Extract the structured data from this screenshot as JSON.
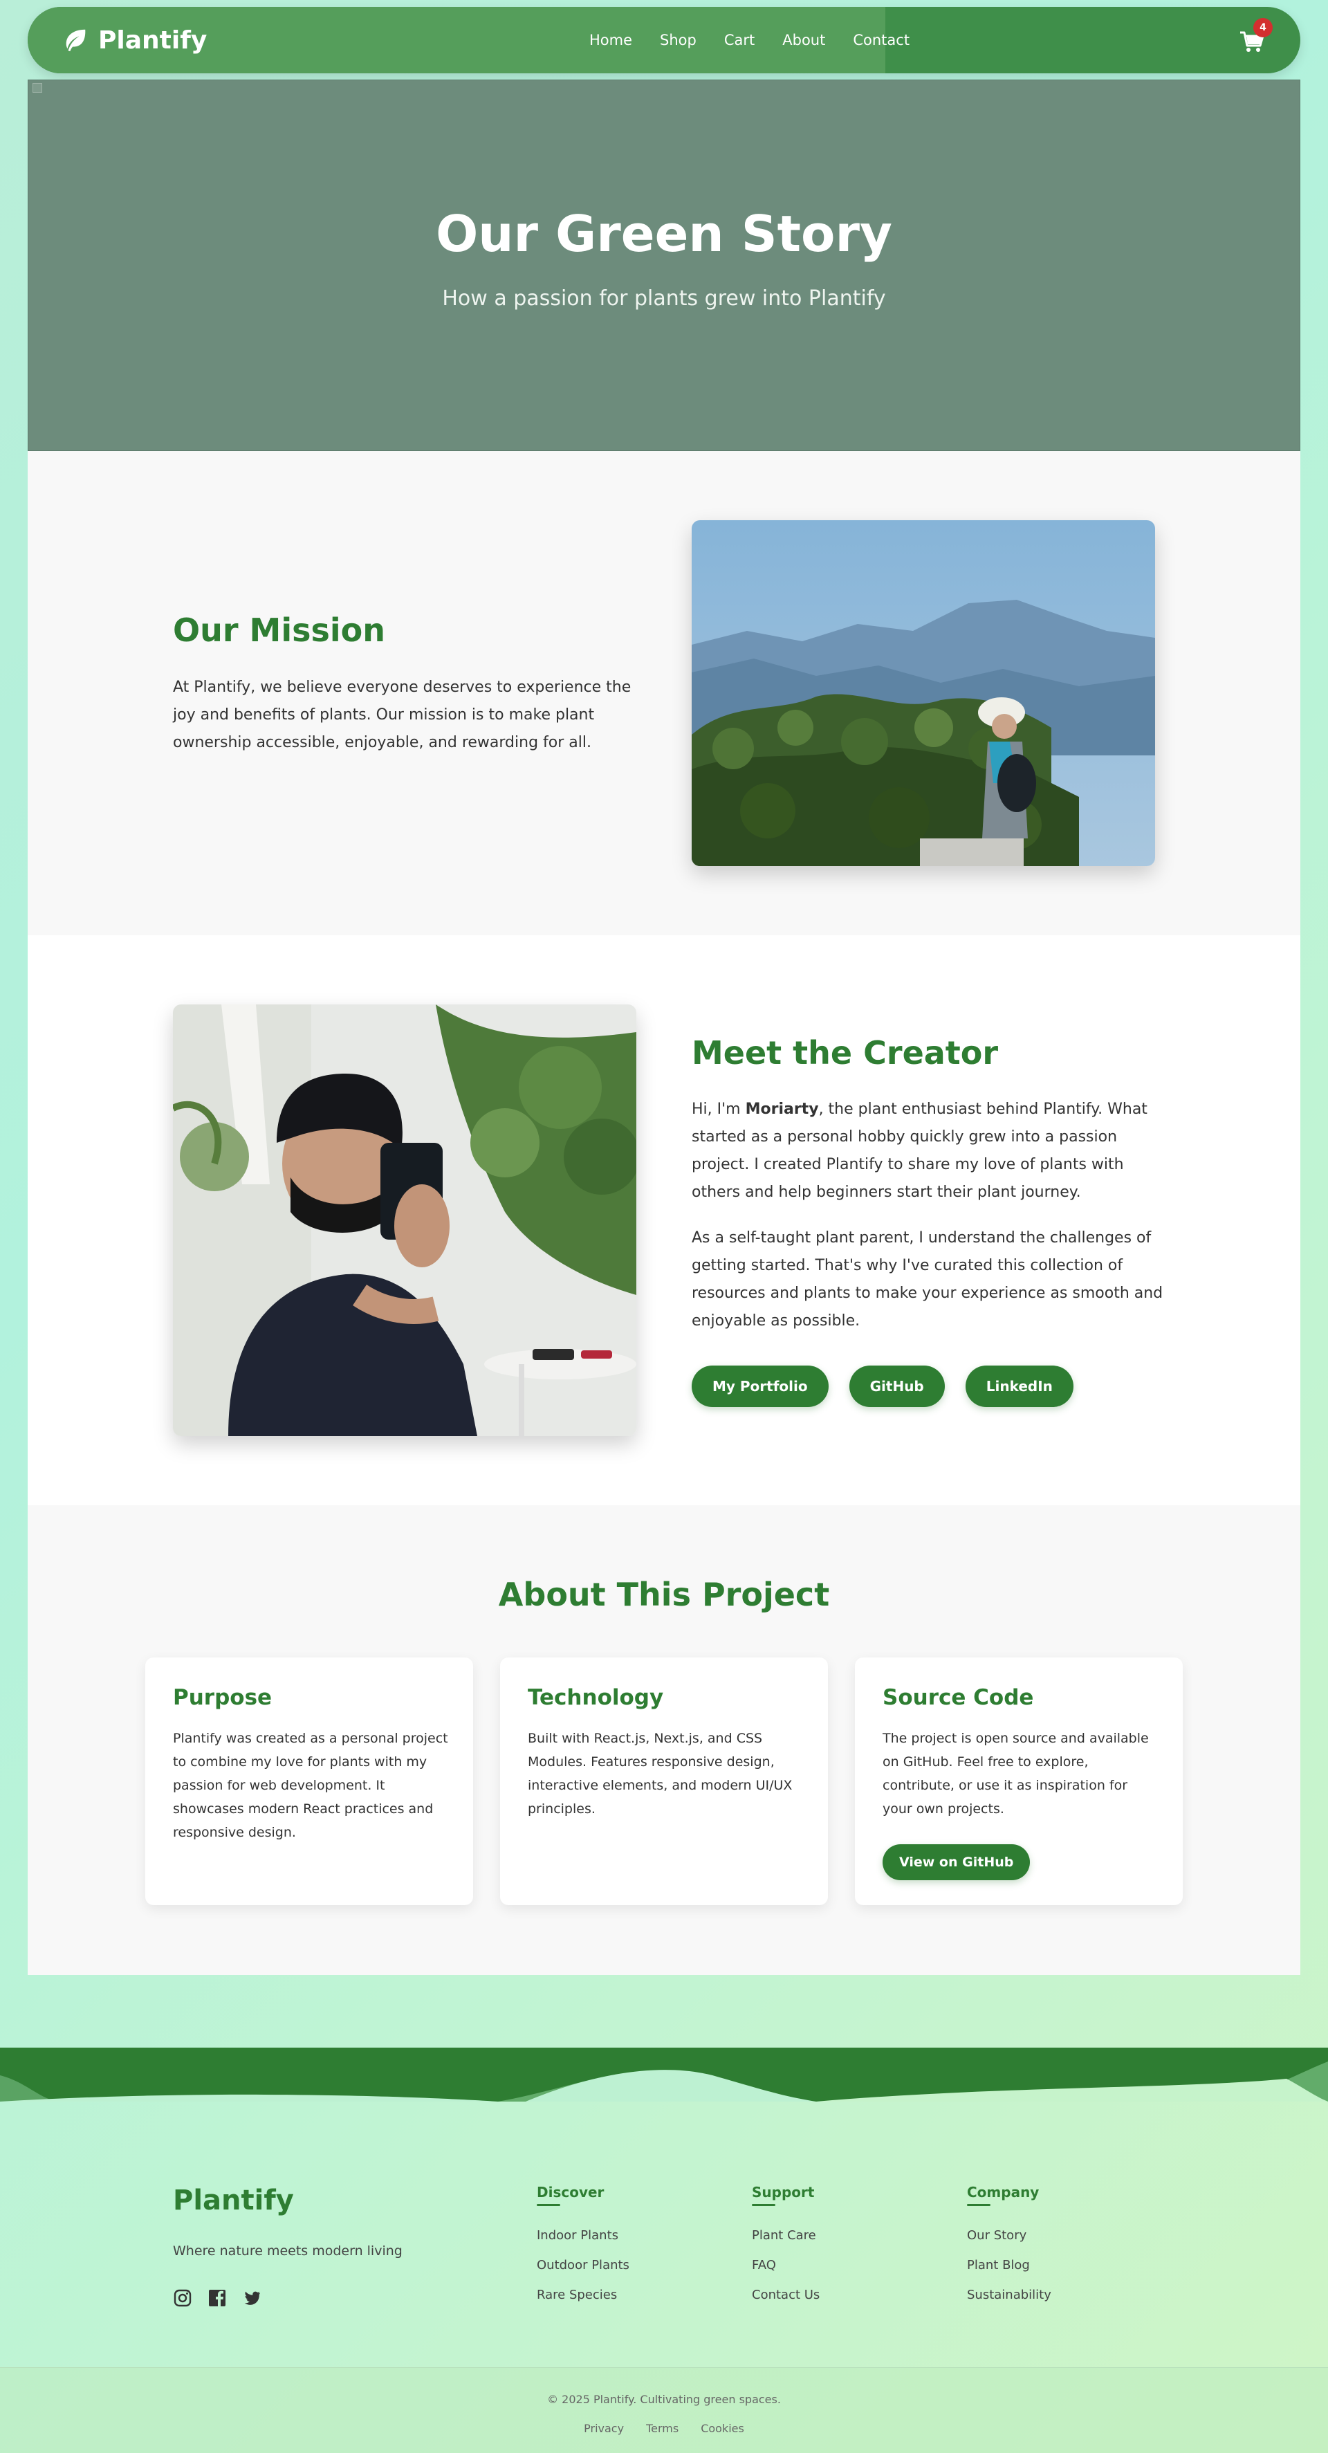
{
  "navbar": {
    "brand": "Plantify",
    "links": [
      "Home",
      "Shop",
      "Cart",
      "About",
      "Contact"
    ],
    "cart_count": "4"
  },
  "hero": {
    "title": "Our Green Story",
    "subtitle": "How a passion for plants grew into Plantify"
  },
  "mission": {
    "title": "Our Mission",
    "text": "At Plantify, we believe everyone deserves to experience the joy and benefits of plants. Our mission is to make plant ownership accessible, enjoyable, and rewarding for all."
  },
  "creator": {
    "title": "Meet the Creator",
    "p1_before": "Hi, I'm ",
    "p1_name": "Moriarty",
    "p1_after": ", the plant enthusiast behind Plantify. What started as a personal hobby quickly grew into a passion project. I created Plantify to share my love of plants with others and help beginners start their plant journey.",
    "p2": "As a self-taught plant parent, I understand the challenges of getting started. That's why I've curated this collection of resources and plants to make your experience as smooth and enjoyable as possible.",
    "buttons": [
      "My Portfolio",
      "GitHub",
      "LinkedIn"
    ]
  },
  "project": {
    "title": "About This Project",
    "cards": [
      {
        "title": "Purpose",
        "text": "Plantify was created as a personal project to combine my love for plants with my passion for web development. It showcases modern React practices and responsive design."
      },
      {
        "title": "Technology",
        "text": "Built with React.js, Next.js, and CSS Modules. Features responsive design, interactive elements, and modern UI/UX principles."
      },
      {
        "title": "Source Code",
        "text": "The project is open source and available on GitHub. Feel free to explore, contribute, or use it as inspiration for your own projects.",
        "button": "View on GitHub"
      }
    ]
  },
  "footer": {
    "brand": "Plantify",
    "tagline": "Where nature meets modern living",
    "socials": [
      "instagram-icon",
      "facebook-icon",
      "twitter-icon"
    ],
    "columns": [
      {
        "title": "Discover",
        "items": [
          "Indoor Plants",
          "Outdoor Plants",
          "Rare Species"
        ]
      },
      {
        "title": "Support",
        "items": [
          "Plant Care",
          "FAQ",
          "Contact Us"
        ]
      },
      {
        "title": "Company",
        "items": [
          "Our Story",
          "Plant Blog",
          "Sustainability"
        ]
      }
    ],
    "copyright": "© 2025 Plantify. Cultivating green spaces.",
    "legal": [
      "Privacy",
      "Terms",
      "Cookies"
    ]
  },
  "colors": {
    "primary": "#2e7d32",
    "nav": "#3f8f4a",
    "hero_overlay": "#6d8c7c",
    "badge": "#d32f2f"
  }
}
